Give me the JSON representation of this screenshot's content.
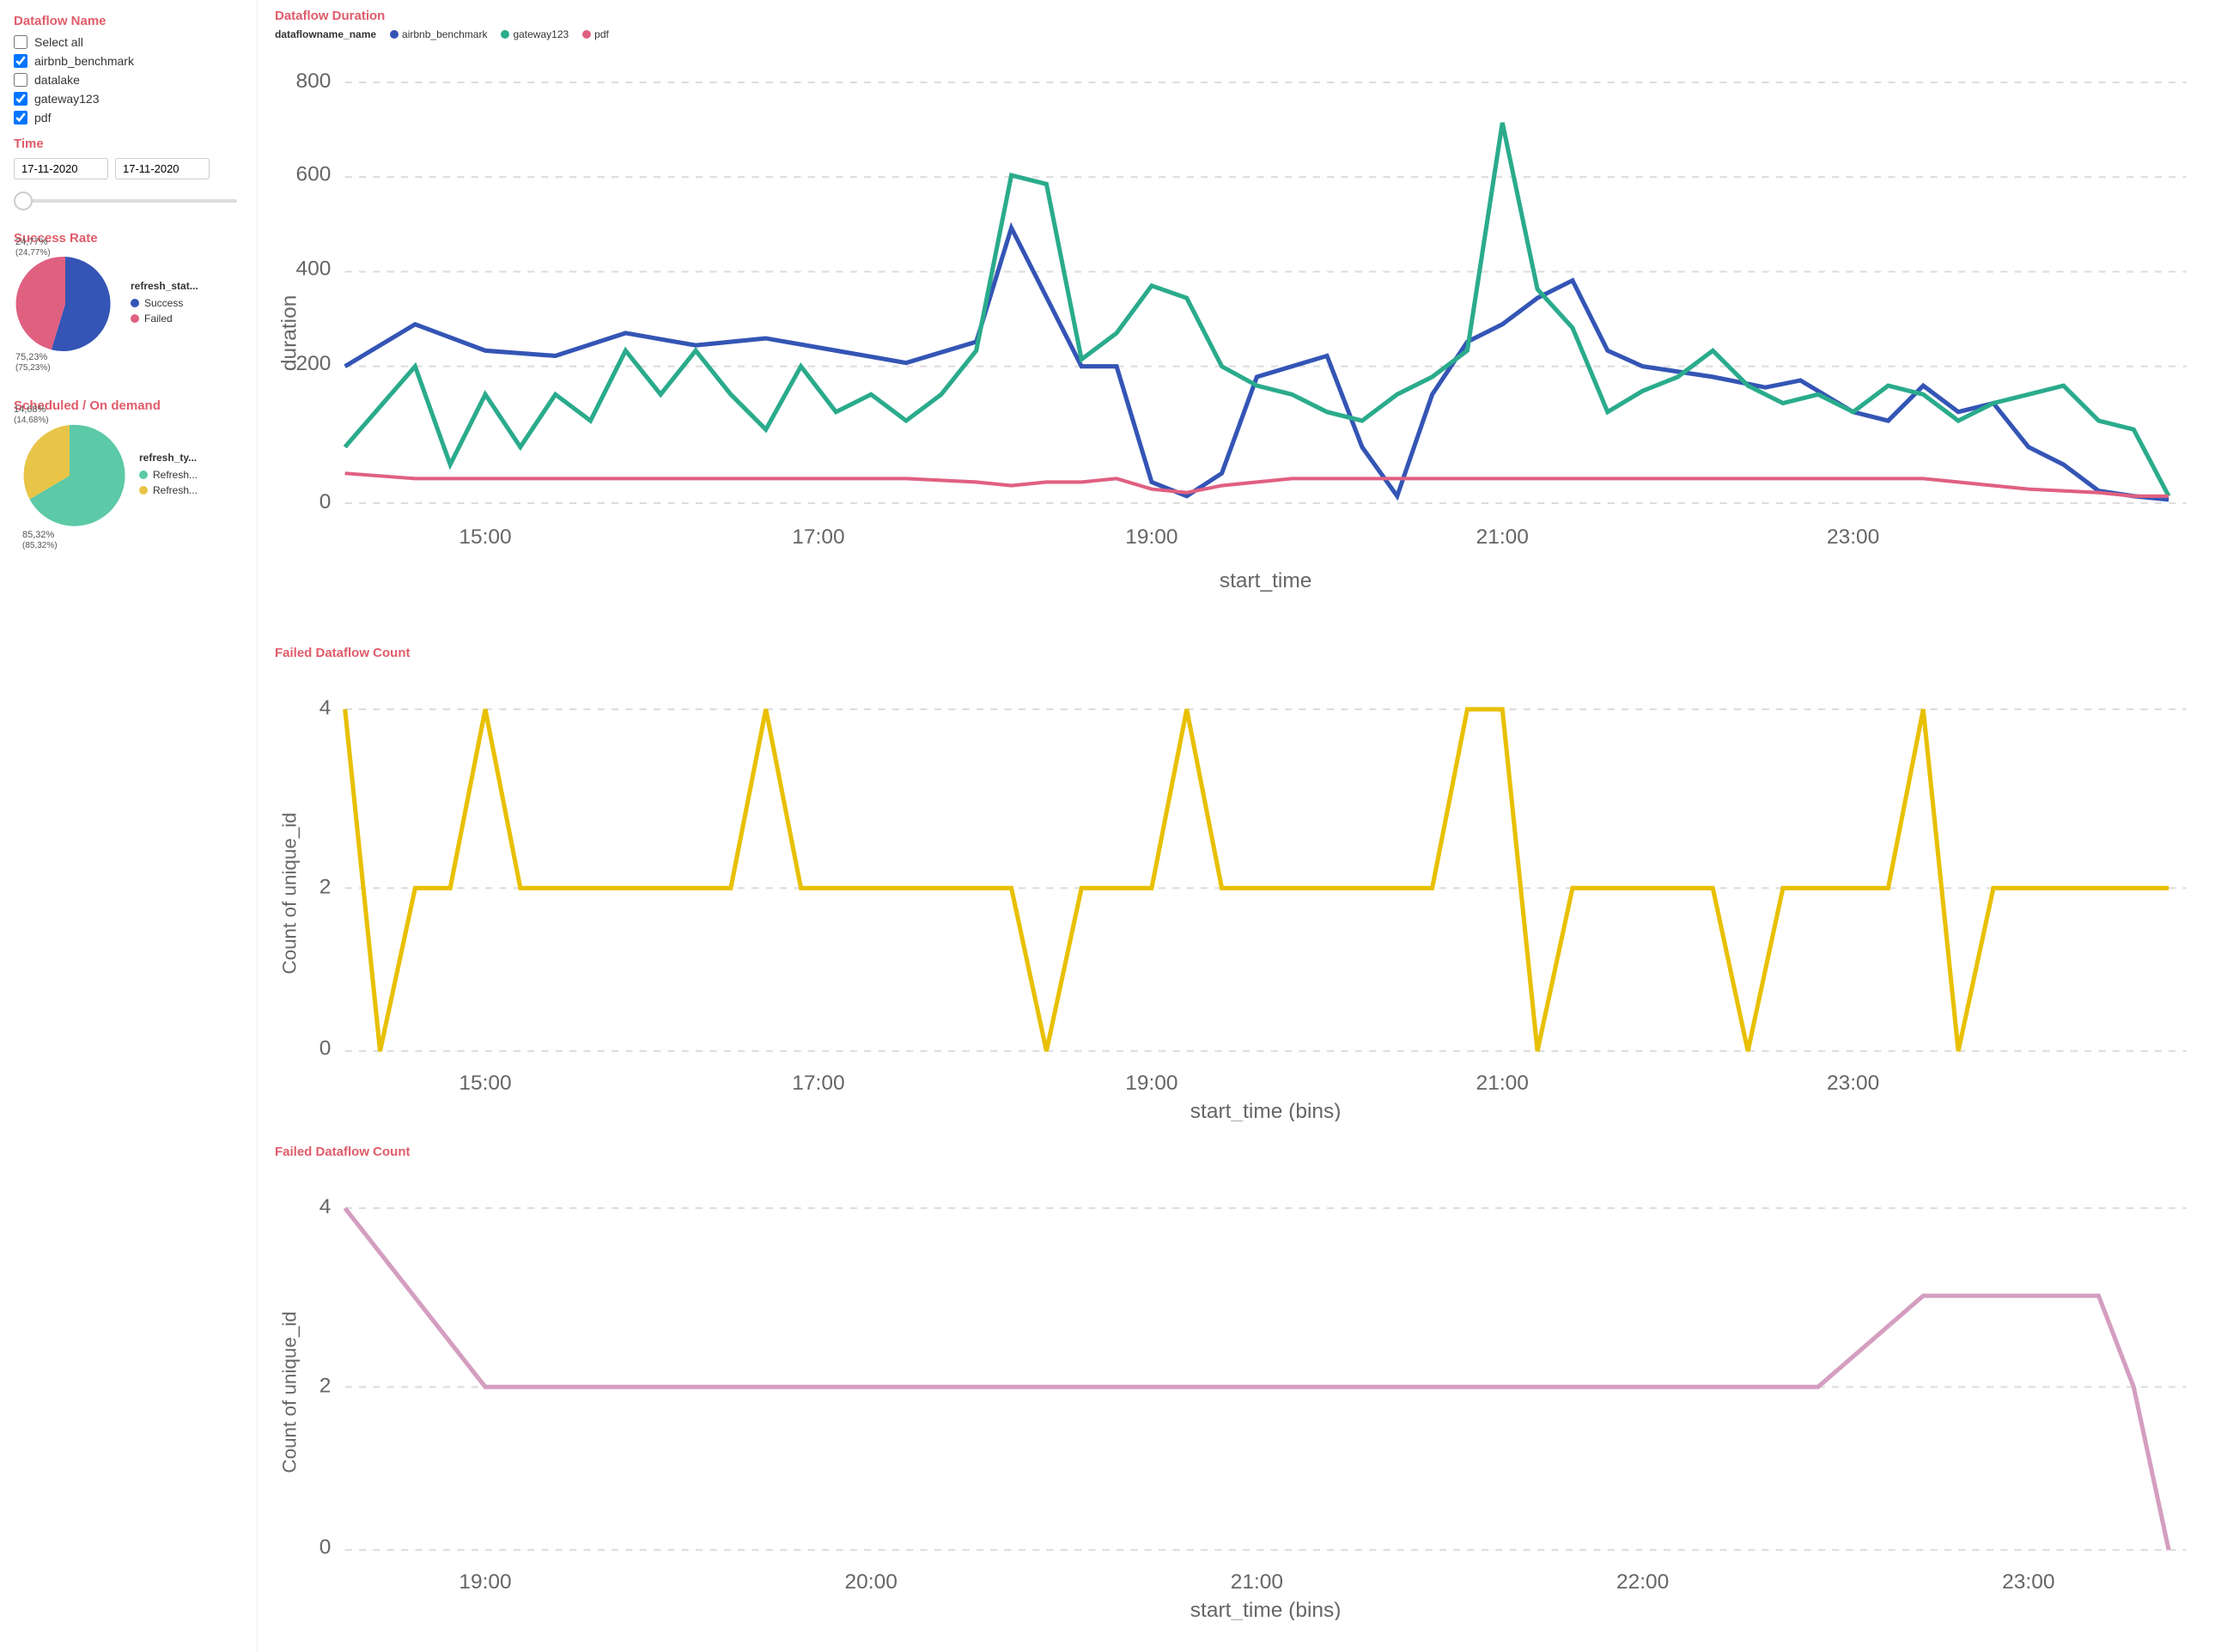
{
  "sidebar": {
    "dataflow_section_title": "Dataflow Name",
    "checkboxes": [
      {
        "id": "select_all",
        "label": "Select all",
        "checked": false
      },
      {
        "id": "airbnb_benchmark",
        "label": "airbnb_benchmark",
        "checked": true
      },
      {
        "id": "datalake",
        "label": "datalake",
        "checked": false
      },
      {
        "id": "gateway123",
        "label": "gateway123",
        "checked": true
      },
      {
        "id": "pdf",
        "label": "pdf",
        "checked": true
      }
    ],
    "time_section_title": "Time",
    "date_from": "17-11-2020",
    "date_to": "17-11-2020"
  },
  "charts": {
    "duration_title": "Dataflow Duration",
    "duration_legend": {
      "field_label": "dataflowname_name",
      "items": [
        {
          "name": "airbnb_benchmark",
          "color": "#3455b5"
        },
        {
          "name": "gateway123",
          "color": "#2aab8c"
        },
        {
          "name": "pdf",
          "color": "#e06080"
        }
      ]
    },
    "duration_yaxis": "duration",
    "duration_xaxis": "start_time",
    "duration_yticks": [
      "800",
      "600",
      "400",
      "200",
      "0"
    ],
    "duration_xticks": [
      "15:00",
      "17:00",
      "19:00",
      "21:00",
      "23:00"
    ],
    "failed_count_title": "Failed Dataflow Count",
    "failed_yaxis": "Count of unique_id",
    "failed_xaxis": "start_time (bins)",
    "failed_yticks": [
      "4",
      "2",
      "0"
    ],
    "failed_xticks": [
      "15:00",
      "17:00",
      "19:00",
      "21:00",
      "23:00"
    ],
    "failed_count2_title": "Failed Dataflow Count",
    "failed2_yaxis": "Count of unique_id",
    "failed2_xaxis": "start_time (bins)",
    "failed2_yticks": [
      "4",
      "2",
      "0"
    ],
    "failed2_xticks": [
      "19:00",
      "20:00",
      "21:00",
      "22:00",
      "23:00"
    ]
  },
  "success_rate": {
    "title": "Success Rate",
    "legend_title": "refresh_stat...",
    "segments": [
      {
        "label": "Success",
        "color": "#3455b5",
        "percent": 75.23,
        "display": "75,23%\n(75,23%)"
      },
      {
        "label": "Failed",
        "color": "#e06080",
        "percent": 24.77,
        "display": "24,77%\n(24,77%)"
      }
    ]
  },
  "scheduled": {
    "title": "Scheduled / On demand",
    "legend_title": "refresh_ty...",
    "segments": [
      {
        "label": "Refresh...",
        "color": "#5cc9a7",
        "percent": 85.32,
        "display": "85,32%\n(85,32%)"
      },
      {
        "label": "Refresh...",
        "color": "#e8c447",
        "percent": 14.68,
        "display": "14,68%\n(14,68%)"
      }
    ]
  }
}
